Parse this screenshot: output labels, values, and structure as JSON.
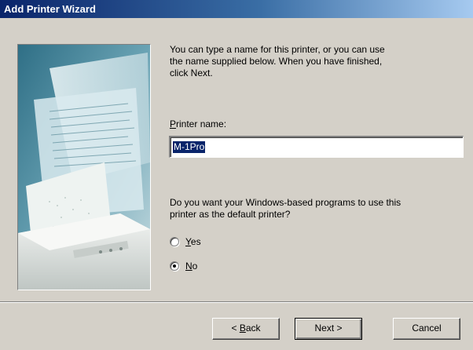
{
  "window": {
    "title": "Add Printer Wizard"
  },
  "intro": {
    "text": "You can type a name for this printer, or you can use\nthe name supplied below. When you have finished,\nclick Next."
  },
  "printer_name": {
    "label_accel": "P",
    "label_rest": "rinter name:",
    "value": "M-1Pro"
  },
  "default_question": {
    "text": "Do you want your Windows-based programs to use this\nprinter as the default printer?",
    "options": [
      {
        "accel": "Y",
        "rest": "es",
        "selected": false
      },
      {
        "accel": "N",
        "rest": "o",
        "selected": true
      }
    ]
  },
  "buttons": {
    "back_prefix": "< ",
    "back_accel": "B",
    "back_rest": "ack",
    "next": "Next >",
    "cancel": "Cancel"
  }
}
